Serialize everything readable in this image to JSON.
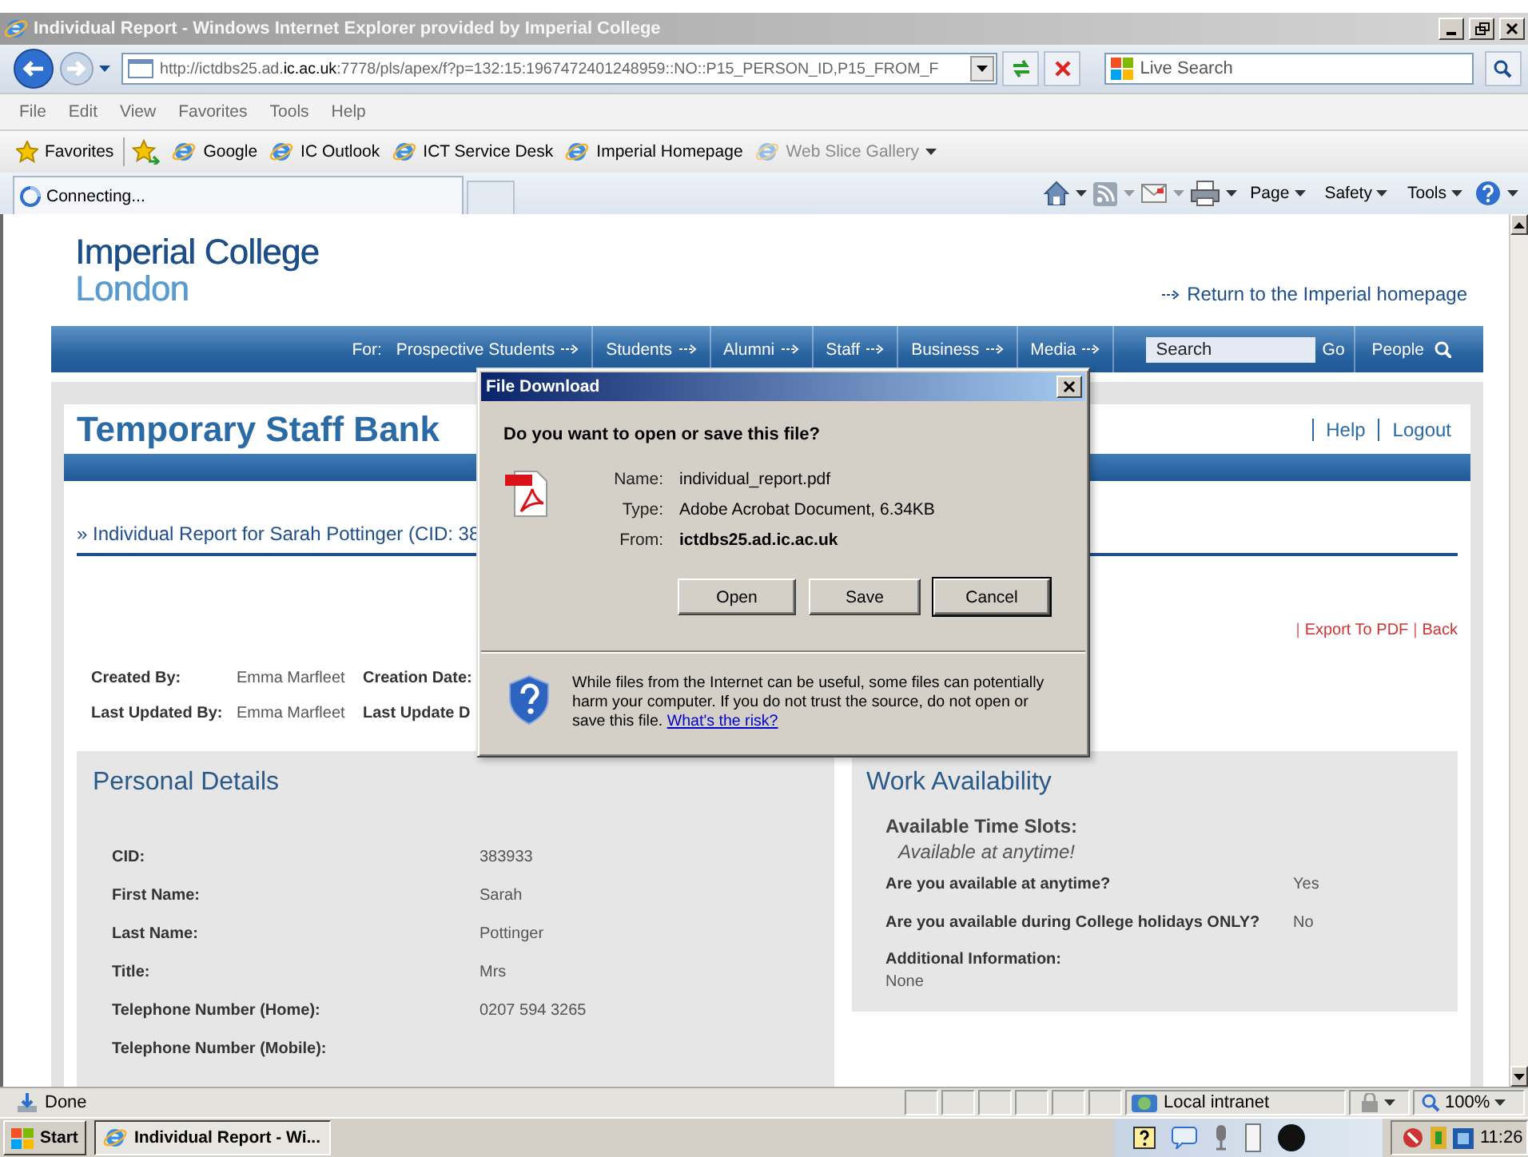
{
  "window": {
    "title": "Individual Report - Windows Internet Explorer provided by Imperial College"
  },
  "address_bar": {
    "url": "http://ictdbs25.ad.**ic.ac.uk**:7778/pls/apex/f?p=132:15:1967472401248959::NO::P15_PERSON_ID,P15_FROM_F"
  },
  "search": {
    "placeholder": "Live Search"
  },
  "menu": [
    "File",
    "Edit",
    "View",
    "Favorites",
    "Tools",
    "Help"
  ],
  "favorites_bar": {
    "label": "Favorites",
    "links": [
      {
        "label": "Google",
        "disabled": false
      },
      {
        "label": "IC Outlook",
        "disabled": false
      },
      {
        "label": "ICT Service Desk",
        "disabled": false
      },
      {
        "label": "Imperial Homepage",
        "disabled": false
      },
      {
        "label": "Web Slice Gallery",
        "disabled": true
      }
    ]
  },
  "tab": {
    "label": "Connecting..."
  },
  "command_bar": [
    "Page",
    "Safety",
    "Tools"
  ],
  "page": {
    "logo": [
      "Imperial College",
      "London"
    ],
    "return_link": "Return to the Imperial homepage",
    "nav": {
      "for_label": "For:",
      "items": [
        "Prospective Students",
        "Students",
        "Alumni",
        "Staff",
        "Business",
        "Media"
      ],
      "search_placeholder": "Search",
      "go": "Go",
      "people": "People"
    },
    "app_title": "Temporary Staff Bank",
    "top_links": [
      "Help",
      "Logout"
    ],
    "breadcrumb": "» Individual Report for Sarah Pottinger (CID: 38",
    "actions": [
      {
        "kind": "separator",
        "text": "|"
      },
      {
        "kind": "link",
        "text": "Export To PDF"
      },
      {
        "kind": "separator",
        "text": "|"
      },
      {
        "kind": "link",
        "text": "Back"
      }
    ],
    "meta": [
      {
        "label": "Created By:",
        "value": "Emma Marfleet",
        "label_2": "Creation Date:"
      },
      {
        "label": "Last Updated By:",
        "value": "Emma Marfleet",
        "label_2": "Last Update D"
      }
    ],
    "personal": {
      "title": "Personal Details",
      "fields": [
        {
          "label": "CID:",
          "value": "383933"
        },
        {
          "label": "First Name:",
          "value": "Sarah"
        },
        {
          "label": "Last Name:",
          "value": "Pottinger"
        },
        {
          "label": "Title:",
          "value": "Mrs"
        },
        {
          "label": "Telephone Number (Home):",
          "value": "0207 594 3265"
        },
        {
          "label": "Telephone Number (Mobile):"
        }
      ]
    },
    "work": {
      "title": "Work Availability",
      "slots_label": "Available Time Slots:",
      "slots_value": "Available at anytime!",
      "questions": [
        {
          "label": "Are you available at anytime?",
          "value": "Yes"
        },
        {
          "label": "Are you available during College holidays ONLY?",
          "value": "No"
        }
      ],
      "additional_label": "Additional Information:",
      "additional_value": "None"
    }
  },
  "dialog": {
    "title": "File Download",
    "question": "Do you want to open or save this file?",
    "rows": [
      {
        "label": "Name:",
        "value": "individual_report.pdf",
        "bold": false
      },
      {
        "label": "Type:",
        "value": "Adobe Acrobat Document, 6.34KB",
        "bold": false
      },
      {
        "label": "From:",
        "value": "ictdbs25.ad.ic.ac.uk",
        "bold": true
      }
    ],
    "buttons": [
      {
        "label": "Open",
        "default": false
      },
      {
        "label": "Save",
        "default": false
      },
      {
        "label": "Cancel",
        "default": true
      }
    ],
    "warning": "While files from the Internet can be useful, some files can potentially harm your computer. If you do not trust the source, do not open or save this file.",
    "risk_link": "What's the risk?"
  },
  "status_bar": {
    "text": "Done",
    "zone": "Local intranet",
    "zoom": "100%"
  },
  "taskbar": {
    "start": "Start",
    "task": "Individual Report - Wi...",
    "clock": "11:26"
  }
}
